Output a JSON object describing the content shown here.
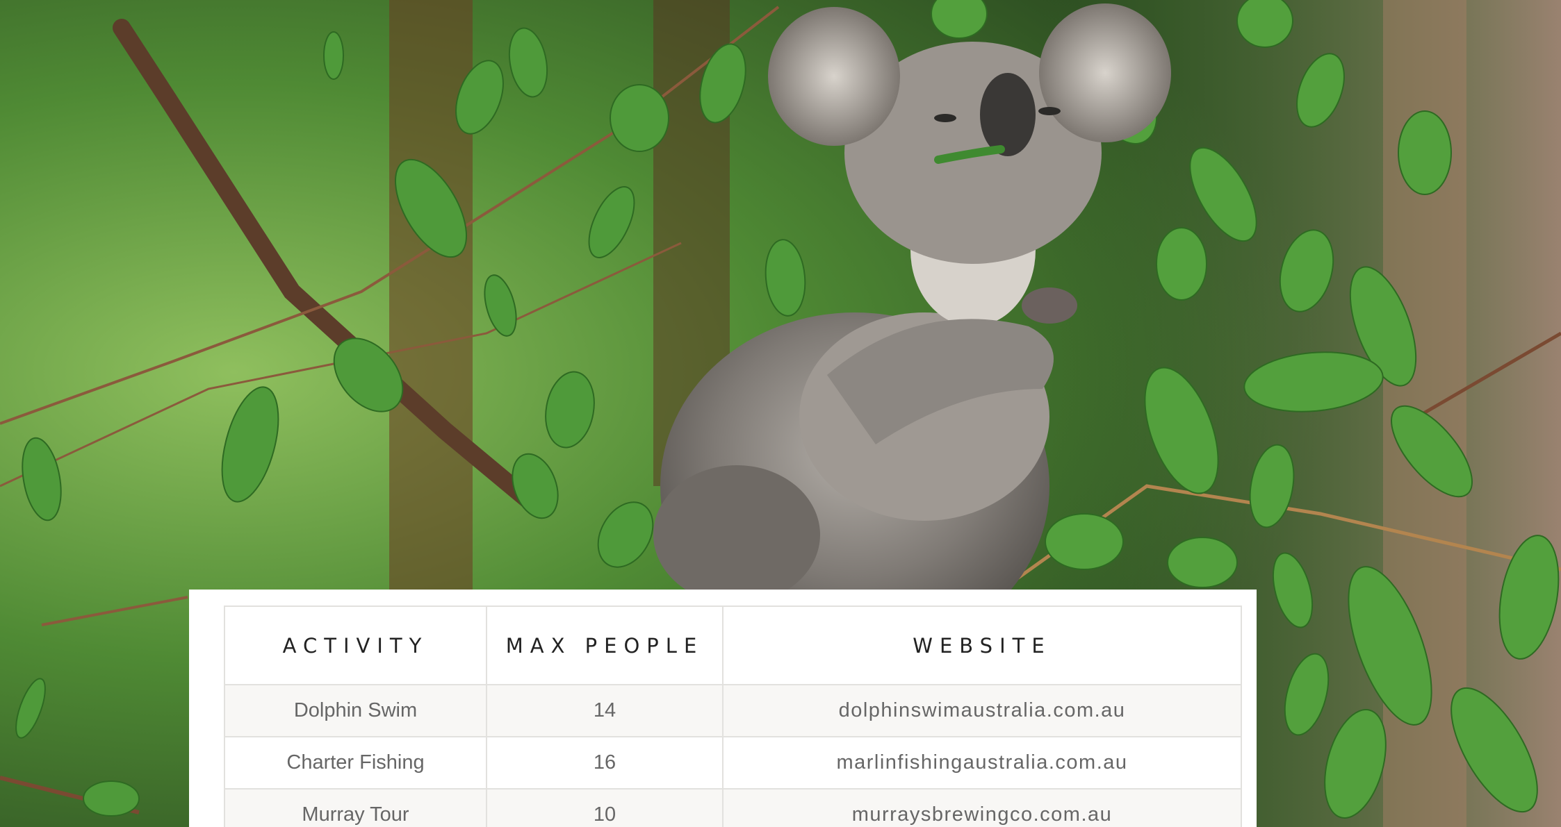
{
  "background": {
    "icon": "koala-photo",
    "colors": {
      "foliage": "#3e7d2e",
      "leaf": "#4f9a3a",
      "fur": "#8a8682",
      "trunk": "#5c3d2a"
    }
  },
  "table": {
    "headers": [
      "ACTIVITY",
      "MAX PEOPLE",
      "WEBSITE"
    ],
    "rows": [
      {
        "activity": "Dolphin Swim",
        "max_people": "14",
        "website": "dolphinswimaustralia.com.au"
      },
      {
        "activity": "Charter Fishing",
        "max_people": "16",
        "website": "marlinfishingaustralia.com.au"
      },
      {
        "activity": "Murray Tour",
        "max_people": "10",
        "website": "murraysbrewingco.com.au"
      }
    ]
  }
}
